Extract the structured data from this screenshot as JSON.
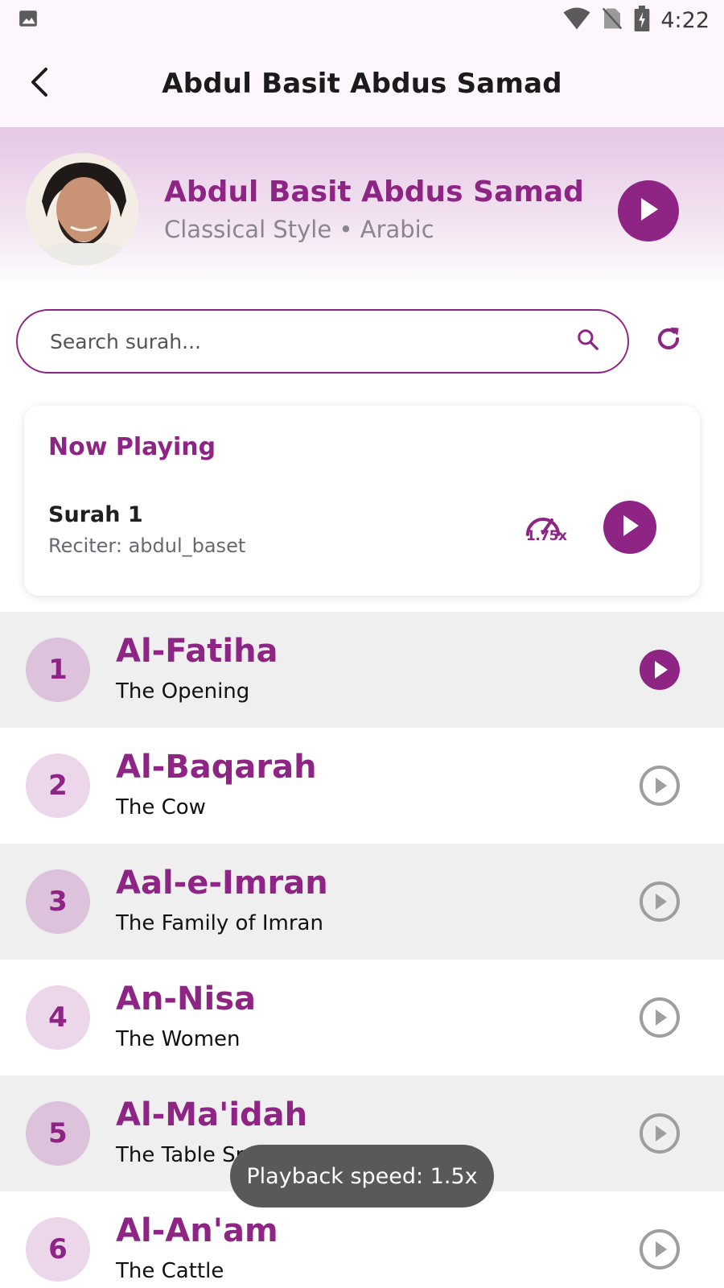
{
  "status_bar": {
    "time": "4:22",
    "icons": [
      "image-icon",
      "wifi-icon",
      "no-sim-icon",
      "battery-charging-icon"
    ]
  },
  "app_bar": {
    "title": "Abdul Basit Abdus Samad",
    "back_icon": "arrow-back-icon"
  },
  "header": {
    "reciter_name": "Abdul Basit Abdus Samad",
    "subtitle": "Classical Style • Arabic",
    "play_icon": "play-icon"
  },
  "search": {
    "placeholder": "Search surah...",
    "value": "",
    "icon": "search-icon",
    "refresh_icon": "refresh-icon"
  },
  "now_playing": {
    "title": "Now Playing",
    "surah": "Surah 1",
    "reciter": "Reciter: abdul_baset",
    "speed_label": "1.75x",
    "speed_icon": "speed-icon",
    "play_icon": "play-icon"
  },
  "surahs": [
    {
      "number": "1",
      "name": "Al-Fatiha",
      "meaning": "The Opening",
      "active": true
    },
    {
      "number": "2",
      "name": "Al-Baqarah",
      "meaning": "The Cow",
      "active": false
    },
    {
      "number": "3",
      "name": "Aal-e-Imran",
      "meaning": "The Family of Imran",
      "active": false
    },
    {
      "number": "4",
      "name": "An-Nisa",
      "meaning": "The Women",
      "active": false
    },
    {
      "number": "5",
      "name": "Al-Ma'idah",
      "meaning": "The Table Spread",
      "active": false
    },
    {
      "number": "6",
      "name": "Al-An'am",
      "meaning": "The Cattle",
      "active": false
    }
  ],
  "toast": {
    "text": "Playback speed: 1.5x"
  },
  "colors": {
    "accent": "#8e2484",
    "row_shaded": "#efefef",
    "row_white": "#ffffff",
    "inactive_play": "#9e9e9e"
  }
}
